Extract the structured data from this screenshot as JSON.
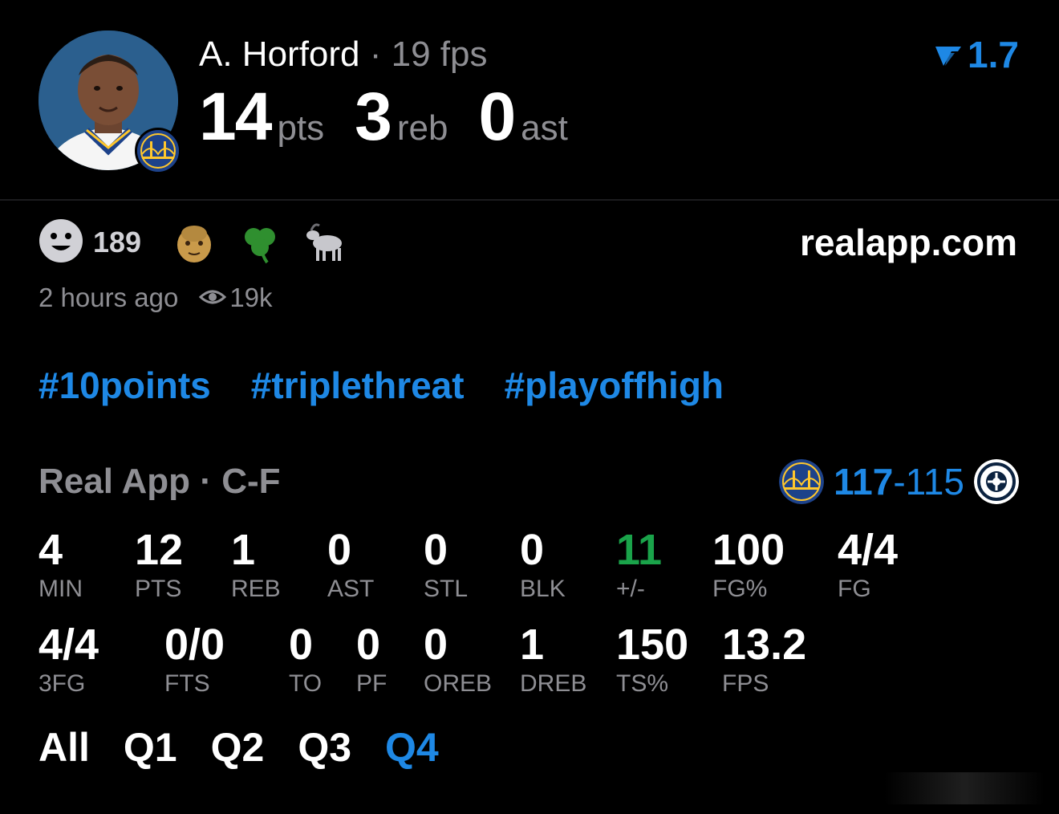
{
  "header": {
    "player_name": "A. Horford",
    "separator": "·",
    "fps_label": "19 fps",
    "pts": "14",
    "pts_unit": "pts",
    "reb": "3",
    "reb_unit": "reb",
    "ast": "0",
    "ast_unit": "ast",
    "rating_value": "1.7",
    "rating_icon": "rating-arrow-icon"
  },
  "reactions": {
    "smiley_count": "189",
    "emojis": [
      "old-man-emoji",
      "shamrock-emoji",
      "goat-emoji"
    ]
  },
  "site": "realapp.com",
  "meta": {
    "time_ago": "2 hours ago",
    "views": "19k"
  },
  "hashtags": [
    "#10points",
    "#triplethreat",
    "#playoffhigh"
  ],
  "game": {
    "source": "Real App",
    "separator": "·",
    "position": "C-F",
    "team_score": "117",
    "dash": "-",
    "opp_score": "115"
  },
  "stats": {
    "row1": [
      {
        "value": "4",
        "label": "MIN"
      },
      {
        "value": "12",
        "label": "PTS"
      },
      {
        "value": "1",
        "label": "REB"
      },
      {
        "value": "0",
        "label": "AST"
      },
      {
        "value": "0",
        "label": "STL"
      },
      {
        "value": "0",
        "label": "BLK"
      },
      {
        "value": "11",
        "label": "+/-"
      },
      {
        "value": "100",
        "label": "FG%"
      },
      {
        "value": "4/4",
        "label": "FG"
      }
    ],
    "row2": [
      {
        "value": "4/4",
        "label": "3FG"
      },
      {
        "value": "0/0",
        "label": "FTS"
      },
      {
        "value": "0",
        "label": "TO"
      },
      {
        "value": "0",
        "label": "PF"
      },
      {
        "value": "0",
        "label": "OREB"
      },
      {
        "value": "1",
        "label": "DREB"
      },
      {
        "value": "150",
        "label": "TS%"
      },
      {
        "value": "13.2",
        "label": "FPS"
      }
    ]
  },
  "tabs": [
    "All",
    "Q1",
    "Q2",
    "Q3",
    "Q4"
  ],
  "active_tab": "Q4",
  "colors": {
    "accent": "#1e88e5",
    "positive": "#1aa34a",
    "muted": "#8e8e93",
    "background": "#000000"
  }
}
